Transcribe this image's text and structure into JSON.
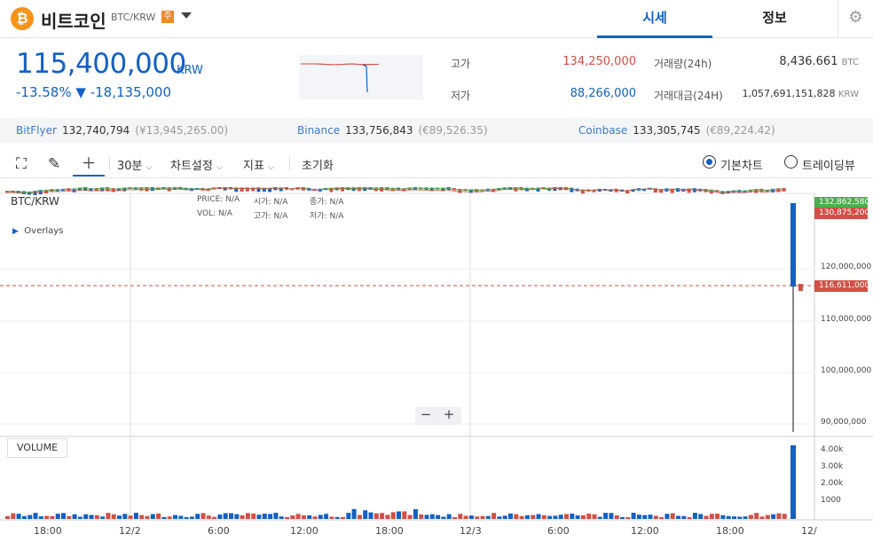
{
  "header": {
    "coin_symbol": "₿",
    "coin_name": "비트코인",
    "pair": "BTC/KRW",
    "warning_badge": "주",
    "tabs": [
      "시세",
      "정보"
    ],
    "settings_icon": "gear-icon"
  },
  "price": {
    "current": "115,400,000",
    "unit": "KRW",
    "change_percent": "-13.58%",
    "change_arrow": "▼",
    "change_amount": "-18,135,000"
  },
  "stats": {
    "high_label": "고가",
    "high_value": "134,250,000",
    "low_label": "저가",
    "low_value": "88,266,000",
    "volume_label": "거래량(24h)",
    "volume_value": "8,436.661",
    "volume_unit": "BTC",
    "amount_label": "거래대금(24H)",
    "amount_value": "1,057,691,151,828",
    "amount_unit": "KRW"
  },
  "exchanges": [
    {
      "name": "BitFlyer",
      "price": "132,740,794",
      "alt": "(¥13,945,265.00)"
    },
    {
      "name": "Binance",
      "price": "133,756,843",
      "alt": "(€89,526.35)"
    },
    {
      "name": "Coinbase",
      "price": "133,305,745",
      "alt": "(€89,224.42)"
    }
  ],
  "toolbar": {
    "interval": "30분",
    "chart_settings": "차트설정",
    "indicators": "지표",
    "reset": "초기화",
    "basic_chart": "기본차트",
    "tradingview": "트레이딩뷰"
  },
  "chart": {
    "pair_label": "BTC/KRW",
    "overlays_label": "Overlays",
    "volume_label": "VOLUME",
    "ohlc": {
      "price_label": "PRICE:",
      "price_val": "N/A",
      "open_label": "시가:",
      "open_val": "N/A",
      "close_label": "종가:",
      "close_val": "N/A",
      "vol_label": "VOL:",
      "vol_val": "N/A",
      "high_label": "고가:",
      "high_val": "N/A",
      "low_label": "저가:",
      "low_val": "N/A"
    },
    "price_tags": {
      "green": "132,862,580",
      "red_top": "130,875,200",
      "current": "116,611,000"
    },
    "y_ticks": [
      "120,000,000",
      "110,000,000",
      "100,000,000",
      "90,000,000"
    ],
    "vol_ticks": [
      "4.00k",
      "3.00k",
      "2.00k",
      "1000"
    ],
    "x_ticks": [
      "18:00",
      "12/2",
      "6:00",
      "12:00",
      "18:00",
      "12/3",
      "6:00",
      "12:00",
      "18:00",
      "12/"
    ],
    "colors": {
      "up": "#d24f45",
      "down": "#1261c4",
      "ma_green": "#4cae4c",
      "ma_red": "#d24f45"
    }
  }
}
